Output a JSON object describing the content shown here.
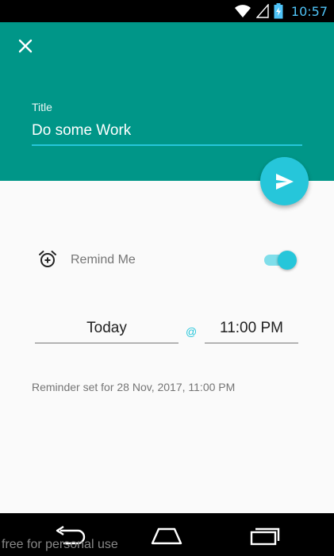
{
  "status_bar": {
    "time": "10:57",
    "icons": [
      "wifi-icon",
      "signal-icon",
      "battery-charging-icon"
    ]
  },
  "header": {
    "close_icon": "close-icon",
    "title_label": "Title",
    "title_value": "Do some Work",
    "colors": {
      "background": "#009688",
      "underline": "#26c6da"
    }
  },
  "fab": {
    "icon": "send-icon",
    "color": "#26c6da"
  },
  "reminder": {
    "icon": "alarm-add-icon",
    "label": "Remind Me",
    "enabled": true,
    "date": "Today",
    "at": "@",
    "time": "11:00 PM",
    "summary": "Reminder set for 28 Nov, 2017, 11:00 PM"
  },
  "nav_bar": {
    "buttons": [
      "back-icon",
      "home-icon",
      "recents-icon"
    ]
  },
  "watermark": "free for personal use"
}
